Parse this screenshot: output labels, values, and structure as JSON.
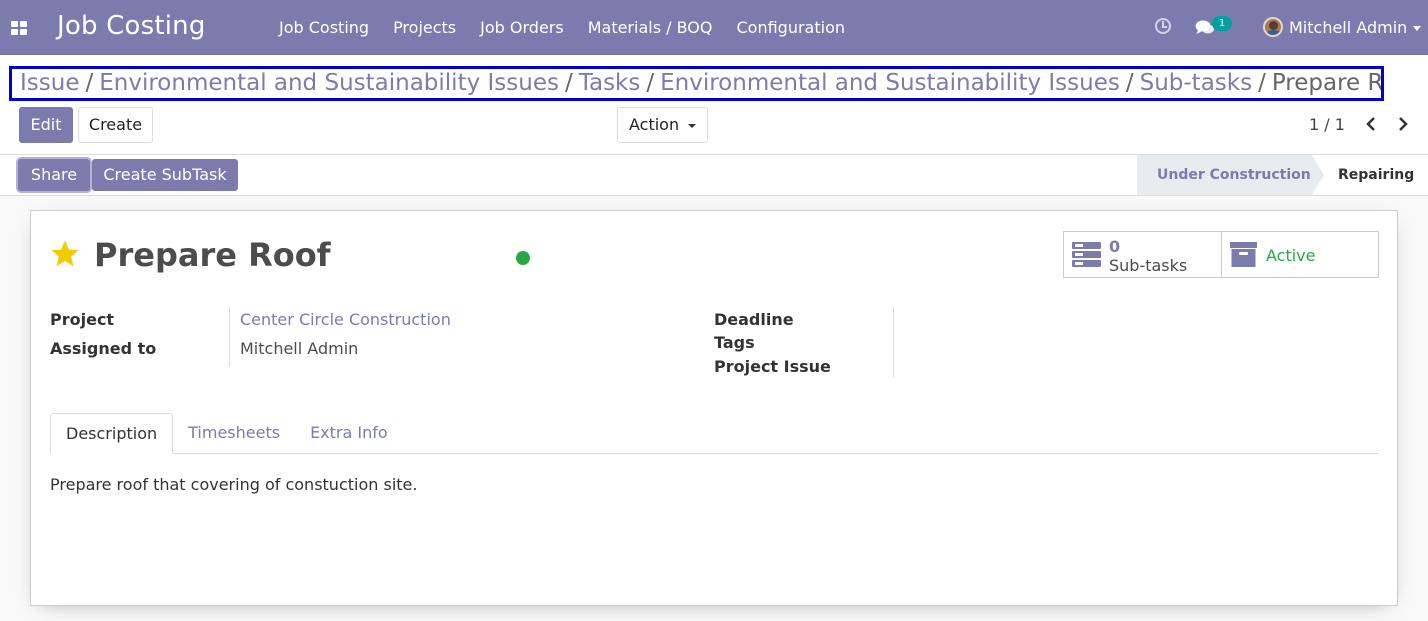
{
  "navbar": {
    "brand": "Job Costing",
    "menu": [
      "Job Costing",
      "Projects",
      "Job Orders",
      "Materials / BOQ",
      "Configuration"
    ],
    "chat_badge": "1",
    "user_name": "Mitchell Admin"
  },
  "breadcrumb": {
    "links": [
      "Issue",
      "Environmental and Sustainability Issues",
      "Tasks",
      "Environmental and Sustainability Issues",
      "Sub-tasks"
    ],
    "separator": "/",
    "current": "Prepare Roof"
  },
  "toolbar": {
    "edit_label": "Edit",
    "create_label": "Create",
    "action_label": "Action",
    "pager": "1 / 1"
  },
  "statusbar": {
    "share_label": "Share",
    "create_subtask_label": "Create SubTask",
    "stages": [
      "Under Construction",
      "Repairing"
    ],
    "current_stage": "Repairing"
  },
  "form": {
    "title": "Prepare Roof",
    "starred": true,
    "kanban_state_color": "#28a745",
    "smart_buttons": {
      "subtasks_count": "0",
      "subtasks_label": "Sub-tasks",
      "active_label": "Active"
    },
    "left_fields": [
      {
        "label": "Project",
        "value": "Center Circle Construction"
      },
      {
        "label": "Assigned to",
        "value": "Mitchell Admin"
      }
    ],
    "right_fields": [
      {
        "label": "Deadline",
        "value": ""
      },
      {
        "label": "Tags",
        "value": ""
      },
      {
        "label": "Project Issue",
        "value": ""
      }
    ],
    "tabs": [
      "Description",
      "Timesheets",
      "Extra Info"
    ],
    "active_tab": "Description",
    "description": "Prepare roof that covering of constuction site."
  },
  "colors": {
    "primary": "#7c7bad",
    "success": "#28a745",
    "badge": "#00a09d"
  }
}
